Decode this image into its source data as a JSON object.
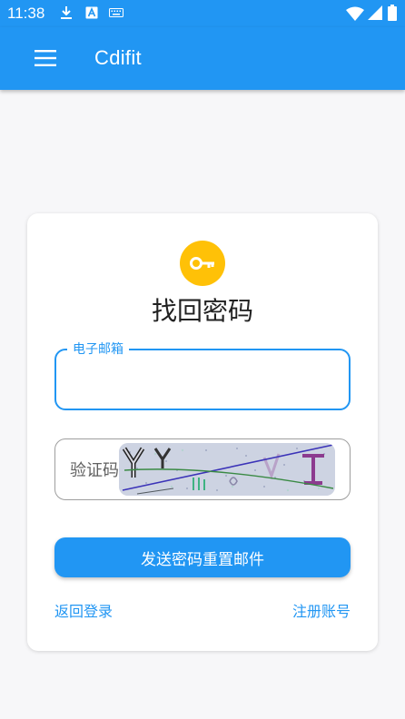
{
  "status_bar": {
    "time": "11:38"
  },
  "app_bar": {
    "title": "Cdifit"
  },
  "form": {
    "title": "找回密码",
    "email_label": "电子邮箱",
    "email_value": "",
    "captcha_placeholder": "验证码",
    "captcha_value": "",
    "send_button": "发送密码重置邮件",
    "back_link": "返回登录",
    "register_link": "注册账号"
  },
  "colors": {
    "primary": "#2196f3",
    "key_icon_bg": "#ffc107"
  }
}
